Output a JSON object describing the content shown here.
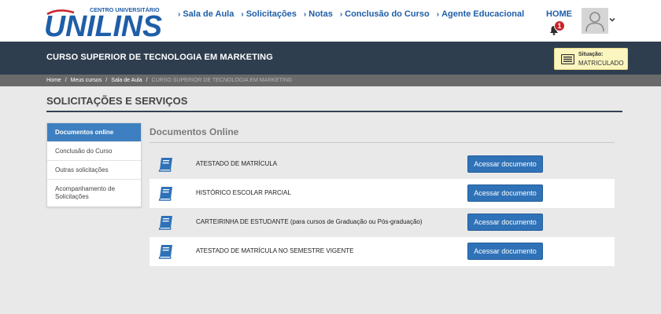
{
  "brand": {
    "top_text": "CENTRO UNIVERSITÁRIO",
    "name": "UNILINS"
  },
  "nav": {
    "items": [
      {
        "label": "Sala de Aula"
      },
      {
        "label": "Solicitações"
      },
      {
        "label": "Notas"
      },
      {
        "label": "Conclusão do Curso"
      },
      {
        "label": "Agente Educacional"
      }
    ],
    "home_label": "HOME",
    "notification_count": "1"
  },
  "banner": {
    "course_title": "CURSO SUPERIOR DE TECNOLOGIA EM MARKETING",
    "status_label": "Situação:",
    "status_value": "MATRICULADO"
  },
  "breadcrumb": {
    "items": [
      "Home",
      "Meus cursos",
      "Sala de Aula"
    ],
    "current": "CURSO SUPERIOR DE TECNOLOGIA EM MARKETING"
  },
  "page": {
    "title": "SOLICITAÇÕES E SERVIÇOS"
  },
  "sidebar": {
    "items": [
      {
        "label": "Documentos online"
      },
      {
        "label": "Conclusão do Curso"
      },
      {
        "label": "Outras solicitações"
      },
      {
        "label": "Acompanhamento de Solicitações"
      }
    ]
  },
  "content": {
    "title": "Documentos Online",
    "documents": [
      {
        "label": "ATESTADO DE MATRÍCULA",
        "button": "Acessar documento"
      },
      {
        "label": "HISTÓRICO ESCOLAR PARCIAL",
        "button": "Acessar documento"
      },
      {
        "label": "CARTEIRINHA DE ESTUDANTE (para cursos de Graduação ou Pós-graduação)",
        "button": "Acessar documento"
      },
      {
        "label": "ATESTADO DE MATRÍCULA NO SEMESTRE VIGENTE",
        "button": "Acessar documento"
      }
    ]
  },
  "colors": {
    "brand_blue": "#1f5ea8",
    "banner_bg": "#2f3e4f",
    "button_blue": "#2f72b8",
    "badge_red": "#c9222a",
    "status_bg": "#fbf5bf"
  },
  "icons": {
    "nav": "chevron-right-icon",
    "notification": "bell-icon",
    "status": "id-card-icon",
    "document": "book-icon",
    "avatar": "user-avatar-icon"
  }
}
